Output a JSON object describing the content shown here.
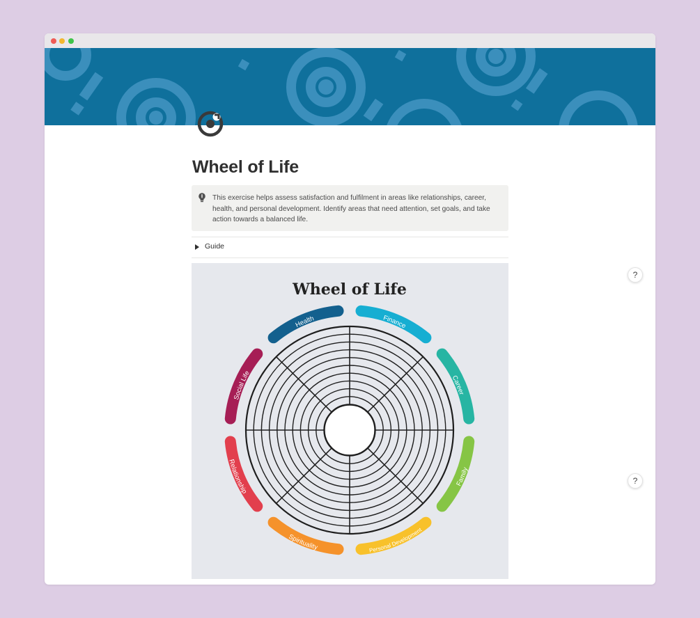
{
  "page": {
    "title": "Wheel of Life",
    "callout_text": "This exercise helps assess satisfaction and fulfilment in areas like relationships, career, health, and personal development. Identify areas that need attention, set goals, and take action towards a balanced life.",
    "toggle_label": "Guide",
    "icon": "target-icon",
    "callout_icon": "lightbulb-icon"
  },
  "wheel": {
    "title": "Wheel of Life",
    "segments": [
      {
        "label": "Health",
        "color": "#13608e"
      },
      {
        "label": "Finance",
        "color": "#16aed2"
      },
      {
        "label": "Career",
        "color": "#27b5a3"
      },
      {
        "label": "Family",
        "color": "#86c545"
      },
      {
        "label": "Personal Development",
        "color": "#f8c12b"
      },
      {
        "label": "Spirituality",
        "color": "#f5922b"
      },
      {
        "label": "Relationship",
        "color": "#e23f4d"
      },
      {
        "label": "Social Life",
        "color": "#a61e55"
      }
    ]
  },
  "help": {
    "label": "?"
  },
  "colors": {
    "background": "#ddcde4",
    "cover": "#0f709c",
    "callout_bg": "#f1f1ef"
  }
}
